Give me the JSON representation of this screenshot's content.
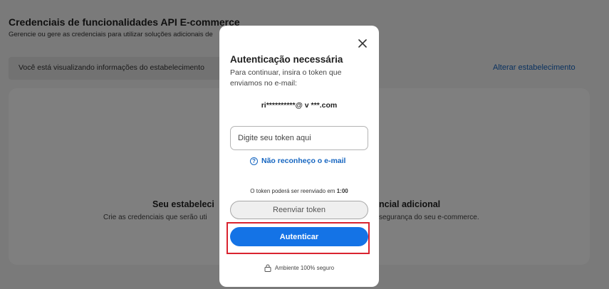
{
  "page": {
    "title": "Credenciais de funcionalidades API E-commerce",
    "subtitle": "Gerencie ou gere as credenciais para utilizar soluções adicionais de",
    "info_text": "Você está visualizando informações do estabelecimento",
    "change_link": "Alterar estabelecimento",
    "empty_title_left": "Seu estabeleci",
    "empty_title_right": "ncial adicional",
    "empty_desc_left": "Crie as credenciais que serão uti",
    "empty_desc_right": "segurança do seu e-commerce."
  },
  "modal": {
    "title": "Autenticação necessária",
    "description": "Para continuar, insira o token que enviamos no e-mail:",
    "masked_email": "ri**********@  v   ***.com",
    "input_placeholder": "Digite seu token aqui",
    "unknown_email_link": "Não reconheço o e-mail",
    "resend_info_prefix": "O token poderá ser reenviado em",
    "resend_timer": "1:00",
    "resend_button": "Reenviar token",
    "auth_button": "Autenticar",
    "secure_text": "Ambiente 100% seguro"
  },
  "icons": {
    "close": "close-icon",
    "help": "help-circle-icon",
    "lock": "lock-icon"
  },
  "colors": {
    "accent": "#1473e6",
    "link": "#1565c0",
    "highlight": "#d9232f"
  }
}
